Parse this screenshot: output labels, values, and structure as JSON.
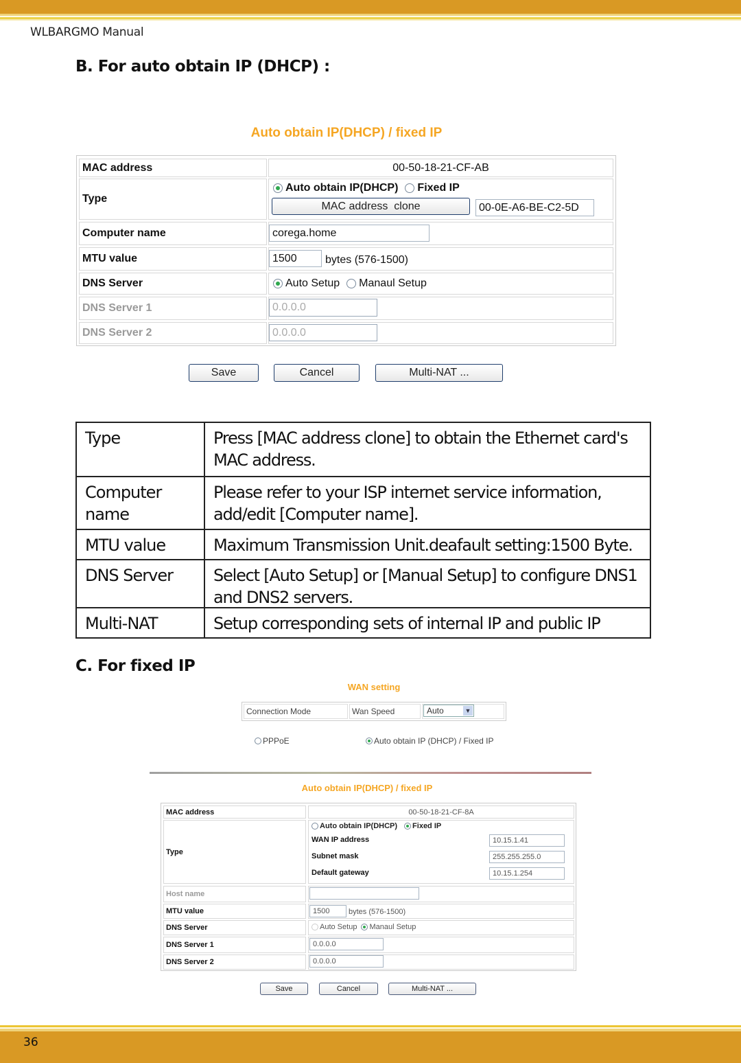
{
  "page": {
    "manual_title": "WLBARGMO Manual",
    "page_number": "36",
    "colors": {
      "band": "#d99924",
      "panel_title": "#f5a623"
    }
  },
  "section_b": {
    "heading": "B. For auto obtain IP (DHCP) :",
    "panel": {
      "title": "Auto obtain IP(DHCP) / fixed IP",
      "mac_address_label": "MAC address",
      "mac_address_value": "00-50-18-21-CF-AB",
      "type_label": "Type",
      "type_options": [
        "Auto obtain IP(DHCP)",
        "Fixed IP"
      ],
      "type_selected": "Auto obtain IP(DHCP)",
      "mac_clone_button": "MAC address  clone",
      "mac_clone_value": "00-0E-A6-BE-C2-5D",
      "computer_name_label": "Computer name",
      "computer_name_value": "corega.home",
      "mtu_label": "MTU value",
      "mtu_value": "1500",
      "mtu_hint": "bytes (576-1500)",
      "dns_label": "DNS Server",
      "dns_options": [
        "Auto Setup",
        "Manaul Setup"
      ],
      "dns_selected": "Auto Setup",
      "dns1_label": "DNS Server 1",
      "dns1_value": "0.0.0.0",
      "dns2_label": "DNS Server 2",
      "dns2_value": "0.0.0.0",
      "buttons": {
        "save": "Save",
        "cancel": "Cancel",
        "multinat": "Multi-NAT ..."
      }
    }
  },
  "description_table": {
    "rows": [
      {
        "term": "Type",
        "desc": "Press [MAC address clone] to obtain the Ethernet card's MAC address."
      },
      {
        "term": "Computer name",
        "desc": "Please refer to your ISP internet service information, add/edit [Computer name]."
      },
      {
        "term": "MTU value",
        "desc": "Maximum Transmission Unit.deafault setting:1500 Byte."
      },
      {
        "term": "DNS Server",
        "desc": "Select [Auto Setup] or [Manual Setup] to configure DNS1 and DNS2 servers."
      },
      {
        "term": "Multi-NAT",
        "desc": "Setup corresponding sets of internal IP and public IP"
      }
    ]
  },
  "section_c": {
    "heading": "C. For fixed IP",
    "wan": {
      "title": "WAN setting",
      "connection_mode_label": "Connection Mode",
      "wan_speed_label": "Wan Speed",
      "wan_speed_value": "Auto",
      "mode_options": [
        "PPPoE",
        "Auto obtain IP (DHCP) / Fixed IP"
      ],
      "mode_selected": "Auto obtain IP (DHCP) / Fixed IP"
    },
    "panel": {
      "title": "Auto obtain IP(DHCP) / fixed IP",
      "mac_address_label": "MAC address",
      "mac_address_value": "00-50-18-21-CF-8A",
      "type_label": "Type",
      "type_options": [
        "Auto obtain IP(DHCP)",
        "Fixed IP"
      ],
      "type_selected": "Fixed IP",
      "wan_ip_label": "WAN IP address",
      "wan_ip_value": "10.15.1.41",
      "subnet_label": "Subnet mask",
      "subnet_value": "255.255.255.0",
      "gateway_label": "Default gateway",
      "gateway_value": "10.15.1.254",
      "host_name_label": "Host name",
      "host_name_value": "",
      "mtu_label": "MTU value",
      "mtu_value": "1500",
      "mtu_hint": "bytes (576-1500)",
      "dns_label": "DNS Server",
      "dns_options": [
        "Auto Setup",
        "Manaul Setup"
      ],
      "dns_selected": "Manaul Setup",
      "dns1_label": "DNS Server 1",
      "dns1_value": "0.0.0.0",
      "dns2_label": "DNS Server 2",
      "dns2_value": "0.0.0.0",
      "buttons": {
        "save": "Save",
        "cancel": "Cancel",
        "multinat": "Multi-NAT ..."
      }
    }
  }
}
